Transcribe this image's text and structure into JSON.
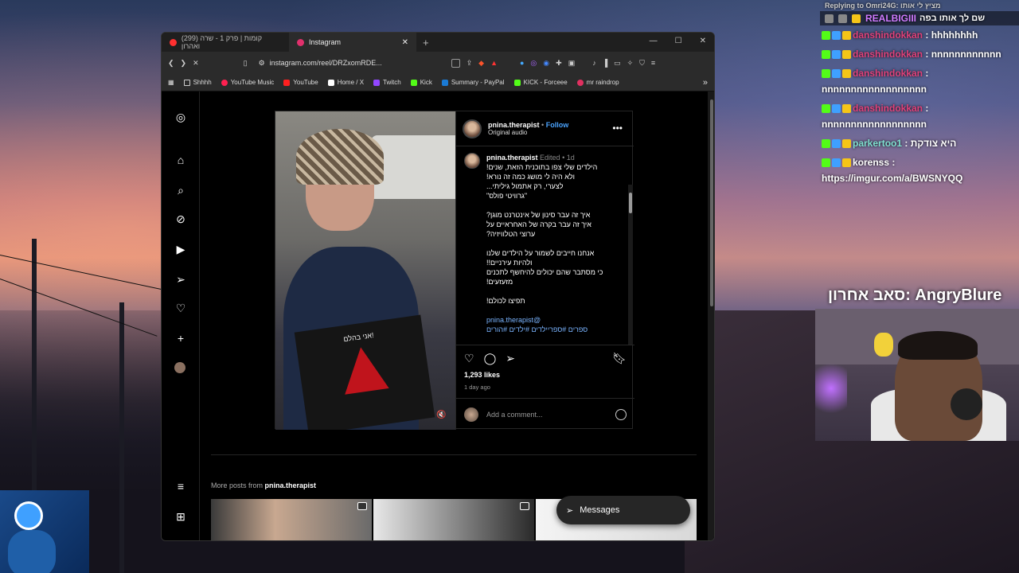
{
  "browser": {
    "tabs": [
      {
        "title": "(299) קומות | פרק 1 - שרה ואהרון",
        "active": false,
        "favicon_color": "#ff3030"
      },
      {
        "title": "Instagram",
        "active": true,
        "favicon_color": "#e1306c"
      }
    ],
    "new_tab": "+",
    "url": "instagram.com/reel/DRZxomRDE...",
    "bookmarks": [
      {
        "label": "Shhhh",
        "color": "#777"
      },
      {
        "label": "YouTube Music",
        "color": "#ff2050"
      },
      {
        "label": "YouTube",
        "color": "#ff2020"
      },
      {
        "label": "Home / X",
        "color": "#fff"
      },
      {
        "label": "Twitch",
        "color": "#9146ff"
      },
      {
        "label": "Kick",
        "color": "#53fc18"
      },
      {
        "label": "Summary - PayPal",
        "color": "#1a7ad4"
      },
      {
        "label": "KICK - Forceee",
        "color": "#53fc18"
      },
      {
        "label": "mr raindrop",
        "color": "#e03060"
      }
    ],
    "bookmarks_more": "»"
  },
  "post": {
    "username": "pnina.therapist",
    "follow_sep": "•",
    "follow": "Follow",
    "audio": "Original audio",
    "more": "•••",
    "edited": "Edited",
    "time": "1d",
    "book_title": "אני בהלם!",
    "caption_lines": [
      "הילדים שלי צפו בתוכנית הזאת, שנים!",
      "ולא היה לי מושג כמה זה נורא!",
      "לצערי, רק אתמול גיליתי...",
      "\"גרוויטי פולס\"",
      "",
      "איך זה עבר סינון של אינטרנט מוגן?",
      "איך זה עבר בקרה של האחראיים על",
      "ערוצי הטלוויזיה?",
      "",
      "אנחנו חייבים לשמור על הילדים שלנו",
      "ולהיות עירניים!!",
      "כי מסתבר שהם יכולים להיחשף לתכנים",
      "מזעזעים!",
      "",
      "תפיצו לכולם!",
      "",
      "@pnina.therapist",
      "ספרים #ספריילדים #ילדים #הורים"
    ],
    "likes": "1,293 likes",
    "ago": "1 day ago",
    "comment_placeholder": "Add a comment..."
  },
  "more_posts": {
    "prefix": "More posts from",
    "user": "pnina.therapist"
  },
  "messages": {
    "label": "Messages"
  },
  "chat": {
    "reply_to": "Replying to Omri24G: מציץ לי אותו",
    "pinned_user": "REALBIGIII",
    "pinned_text": "שם לך אותו בפה",
    "messages": [
      {
        "user": "danshindokkan",
        "text": "hhhhhhhh",
        "color": "#e0417a"
      },
      {
        "user": "danshindokkan",
        "text": "nnnnnnnnnnnn",
        "color": "#e0417a"
      },
      {
        "user": "danshindokkan",
        "text": "nnnnnnnnnnnnnnnnnn",
        "color": "#e0417a"
      },
      {
        "user": "danshindokkan",
        "text": "nnnnnnnnnnnnnnnnnn",
        "color": "#e0417a"
      },
      {
        "user": "parkertoo1",
        "text": "היא צודקת",
        "color": "#7fe0d0"
      },
      {
        "user": "korenss",
        "text": "https://imgur.com/a/BWSNYQQ",
        "color": "#ffffff"
      }
    ]
  },
  "webcam": {
    "title": "סאב אחרון: AngryBlure"
  }
}
